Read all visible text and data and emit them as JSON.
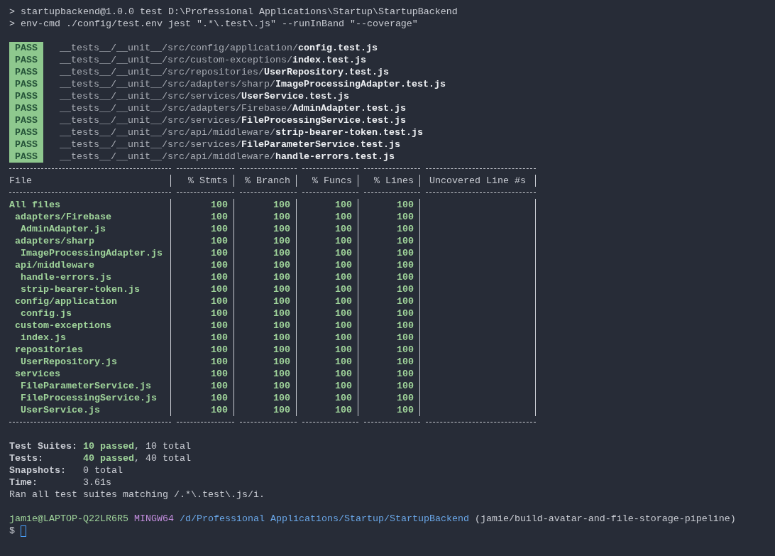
{
  "command_lines": [
    "> startupbackend@1.0.0 test D:\\Professional Applications\\Startup\\StartupBackend",
    "> env-cmd ./config/test.env jest \".*\\.test\\.js\" --runInBand \"--coverage\""
  ],
  "test_results": [
    {
      "status": "PASS",
      "path": "__tests__/__unit__/src/config/application/",
      "file": "config.test.js"
    },
    {
      "status": "PASS",
      "path": "__tests__/__unit__/src/custom-exceptions/",
      "file": "index.test.js"
    },
    {
      "status": "PASS",
      "path": "__tests__/__unit__/src/repositories/",
      "file": "UserRepository.test.js"
    },
    {
      "status": "PASS",
      "path": "__tests__/__unit__/src/adapters/sharp/",
      "file": "ImageProcessingAdapter.test.js"
    },
    {
      "status": "PASS",
      "path": "__tests__/__unit__/src/services/",
      "file": "UserService.test.js"
    },
    {
      "status": "PASS",
      "path": "__tests__/__unit__/src/adapters/Firebase/",
      "file": "AdminAdapter.test.js"
    },
    {
      "status": "PASS",
      "path": "__tests__/__unit__/src/services/",
      "file": "FileProcessingService.test.js"
    },
    {
      "status": "PASS",
      "path": "__tests__/__unit__/src/api/middleware/",
      "file": "strip-bearer-token.test.js"
    },
    {
      "status": "PASS",
      "path": "__tests__/__unit__/src/services/",
      "file": "FileParameterService.test.js"
    },
    {
      "status": "PASS",
      "path": "__tests__/__unit__/src/api/middleware/",
      "file": "handle-errors.test.js"
    }
  ],
  "coverage_table": {
    "columns": [
      "File",
      "% Stmts",
      "% Branch",
      "% Funcs",
      "% Lines",
      "Uncovered Line #s"
    ],
    "rows": [
      {
        "kind": "total",
        "name": "All files",
        "values": [
          "100",
          "100",
          "100",
          "100"
        ]
      },
      {
        "kind": "folder",
        "name": "adapters/Firebase",
        "values": [
          "100",
          "100",
          "100",
          "100"
        ]
      },
      {
        "kind": "file",
        "name": "AdminAdapter.js",
        "values": [
          "100",
          "100",
          "100",
          "100"
        ]
      },
      {
        "kind": "folder",
        "name": "adapters/sharp",
        "values": [
          "100",
          "100",
          "100",
          "100"
        ]
      },
      {
        "kind": "file",
        "name": "ImageProcessingAdapter.js",
        "values": [
          "100",
          "100",
          "100",
          "100"
        ]
      },
      {
        "kind": "folder",
        "name": "api/middleware",
        "values": [
          "100",
          "100",
          "100",
          "100"
        ]
      },
      {
        "kind": "file",
        "name": "handle-errors.js",
        "values": [
          "100",
          "100",
          "100",
          "100"
        ]
      },
      {
        "kind": "file",
        "name": "strip-bearer-token.js",
        "values": [
          "100",
          "100",
          "100",
          "100"
        ]
      },
      {
        "kind": "folder",
        "name": "config/application",
        "values": [
          "100",
          "100",
          "100",
          "100"
        ]
      },
      {
        "kind": "file",
        "name": "config.js",
        "values": [
          "100",
          "100",
          "100",
          "100"
        ]
      },
      {
        "kind": "folder",
        "name": "custom-exceptions",
        "values": [
          "100",
          "100",
          "100",
          "100"
        ]
      },
      {
        "kind": "file",
        "name": "index.js",
        "values": [
          "100",
          "100",
          "100",
          "100"
        ]
      },
      {
        "kind": "folder",
        "name": "repositories",
        "values": [
          "100",
          "100",
          "100",
          "100"
        ]
      },
      {
        "kind": "file",
        "name": "UserRepository.js",
        "values": [
          "100",
          "100",
          "100",
          "100"
        ]
      },
      {
        "kind": "folder",
        "name": "services",
        "values": [
          "100",
          "100",
          "100",
          "100"
        ]
      },
      {
        "kind": "file",
        "name": "FileParameterService.js",
        "values": [
          "100",
          "100",
          "100",
          "100"
        ]
      },
      {
        "kind": "file",
        "name": "FileProcessingService.js",
        "values": [
          "100",
          "100",
          "100",
          "100"
        ]
      },
      {
        "kind": "file",
        "name": "UserService.js",
        "values": [
          "100",
          "100",
          "100",
          "100"
        ]
      }
    ]
  },
  "summary": [
    {
      "label": "Test Suites:",
      "passed": "10 passed",
      "rest": ", 10 total"
    },
    {
      "label": "Tests:",
      "passed": "40 passed",
      "rest": ", 40 total"
    },
    {
      "label": "Snapshots:",
      "rest": "0 total"
    },
    {
      "label": "Time:",
      "rest": "3.61s"
    }
  ],
  "ran_line": "Ran all test suites matching /.*\\.test\\.js/i.",
  "prompt": {
    "user": "jamie@LAPTOP-Q22LR6R5",
    "shell": "MINGW64",
    "path": "/d/Professional Applications/Startup/StartupBackend",
    "branch": "(jamie/build-avatar-and-file-storage-pipeline)",
    "symbol": "$"
  }
}
